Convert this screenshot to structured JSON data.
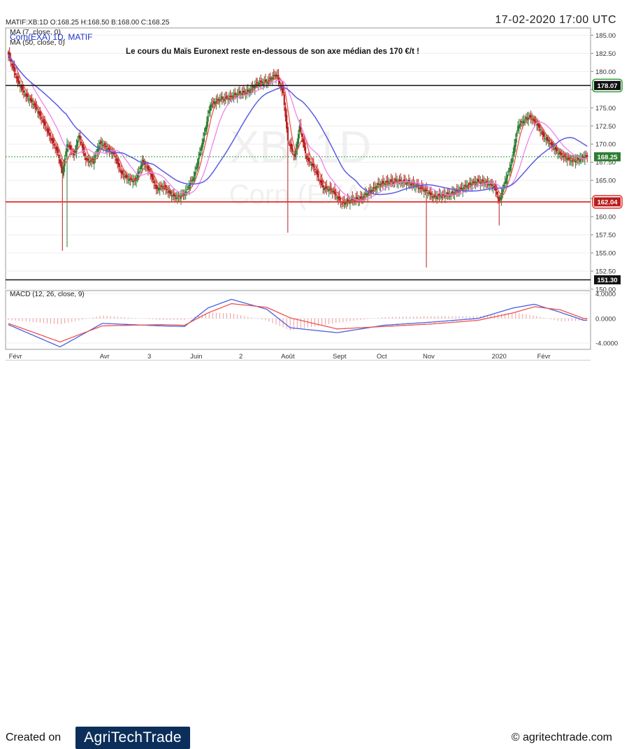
{
  "header": {
    "ohlc": "MATIF:XB:1D O:168.25 H:168.50 B:168.00 C:168.25",
    "datetime": "17-02-2020 17:00 UTC",
    "legend_ma7": "MA (7, close, 0)",
    "legend_symbol": "Corn(EXA) 1D, MATIF",
    "legend_ma50": "MA (50, close, 0)"
  },
  "annotation": "Le cours du Maïs Euronext reste en-dessous de son axe médian des 170 €/t !",
  "watermark": {
    "symbol": "XB, 1D",
    "name": "Corn (EXA)"
  },
  "footer": {
    "created_on": "Created on",
    "logo": "AgriTechTrade",
    "copyright": "© agritechtrade.com"
  },
  "colors": {
    "up": "#2e7d32",
    "down": "#b71c1c",
    "ma7": "#ef5350",
    "ma_pink": "#ee82ee",
    "ma50": "#5b5be6",
    "level_red": "#e53935",
    "level_black": "#111111",
    "macd": "#4a60e0",
    "signal": "#ef5350",
    "hist": "#ef9a9a",
    "badge_green": "#2e9e3a"
  },
  "chart_data": [
    {
      "type": "candlestick",
      "title": "",
      "x_tick_labels": [
        "Févr",
        "Avr",
        "3",
        "Juin",
        "2",
        "Août",
        "Sept",
        "Oct",
        "Nov",
        "2020",
        "Févr"
      ],
      "ylim": [
        150,
        186
      ],
      "y_ticks": [
        "185.00",
        "182.50",
        "180.00",
        "177.50",
        "175.00",
        "172.50",
        "170.00",
        "167.50",
        "165.00",
        "162.50",
        "160.00",
        "157.50",
        "155.00",
        "152.50",
        "150.00"
      ],
      "last_close": 168.25,
      "levels": [
        {
          "value": 178.07,
          "label": "178.07",
          "color": "black",
          "badge": "green"
        },
        {
          "value": 168.25,
          "label": "168.25",
          "color": "green-dotted",
          "badge": "current"
        },
        {
          "value": 162.04,
          "label": "162.04",
          "color": "red",
          "badge": "red"
        },
        {
          "value": 151.3,
          "label": "151.30",
          "color": "black",
          "badge": "none"
        }
      ],
      "series_anchors": {
        "close": [
          [
            0,
            182.3
          ],
          [
            8,
            178.6
          ],
          [
            14,
            176.8
          ],
          [
            22,
            175.4
          ],
          [
            30,
            172.9
          ],
          [
            36,
            170.8
          ],
          [
            42,
            168.8
          ],
          [
            46,
            166.0
          ],
          [
            50,
            170.0
          ],
          [
            56,
            168.5
          ],
          [
            60,
            171.2
          ],
          [
            66,
            167.8
          ],
          [
            72,
            167.6
          ],
          [
            78,
            170.2
          ],
          [
            84,
            169.4
          ],
          [
            90,
            168.6
          ],
          [
            96,
            166.0
          ],
          [
            102,
            165.2
          ],
          [
            108,
            164.9
          ],
          [
            114,
            167.6
          ],
          [
            120,
            166.3
          ],
          [
            126,
            163.8
          ],
          [
            132,
            164.2
          ],
          [
            138,
            163.1
          ],
          [
            144,
            162.6
          ],
          [
            150,
            163.2
          ],
          [
            158,
            165.5
          ],
          [
            166,
            170.8
          ],
          [
            172,
            175.4
          ],
          [
            180,
            176.2
          ],
          [
            188,
            176.4
          ],
          [
            196,
            177.0
          ],
          [
            204,
            177.2
          ],
          [
            212,
            178.4
          ],
          [
            220,
            178.6
          ],
          [
            228,
            179.6
          ],
          [
            234,
            177.0
          ],
          [
            238,
            170.5
          ],
          [
            244,
            168.2
          ],
          [
            248,
            172.5
          ],
          [
            254,
            168.0
          ],
          [
            260,
            166.8
          ],
          [
            268,
            164.0
          ],
          [
            276,
            163.6
          ],
          [
            284,
            161.8
          ],
          [
            292,
            162.3
          ],
          [
            300,
            162.5
          ],
          [
            308,
            163.5
          ],
          [
            316,
            164.5
          ],
          [
            324,
            164.8
          ],
          [
            332,
            164.9
          ],
          [
            340,
            164.7
          ],
          [
            348,
            164.2
          ],
          [
            356,
            163.5
          ],
          [
            362,
            162.7
          ],
          [
            368,
            162.9
          ],
          [
            376,
            163.1
          ],
          [
            384,
            163.7
          ],
          [
            392,
            164.4
          ],
          [
            400,
            164.9
          ],
          [
            408,
            164.6
          ],
          [
            414,
            164.1
          ],
          [
            418,
            162.0
          ],
          [
            422,
            164.4
          ],
          [
            428,
            167.2
          ],
          [
            434,
            172.5
          ],
          [
            440,
            173.4
          ],
          [
            444,
            173.8
          ],
          [
            450,
            172.8
          ],
          [
            456,
            171.0
          ],
          [
            462,
            170.0
          ],
          [
            468,
            168.8
          ],
          [
            474,
            168.2
          ],
          [
            480,
            167.7
          ],
          [
            486,
            167.9
          ],
          [
            490,
            168.25
          ]
        ]
      },
      "spikes": [
        {
          "index": 46,
          "low": 155.3
        },
        {
          "index": 50,
          "low": 155.8
        },
        {
          "index": 238,
          "low": 157.8
        },
        {
          "index": 356,
          "low": 153.0
        },
        {
          "index": 418,
          "low": 158.8
        }
      ]
    },
    {
      "type": "line",
      "title": "MACD (12, 26, close, 9)",
      "ylim": [
        -5,
        4.5
      ],
      "y_ticks": [
        "4.0000",
        "0.0000",
        "-4.0000"
      ],
      "series_anchors": {
        "macd": [
          [
            0,
            -1.0
          ],
          [
            44,
            -4.6
          ],
          [
            80,
            -0.8
          ],
          [
            130,
            -1.2
          ],
          [
            150,
            -1.3
          ],
          [
            170,
            1.7
          ],
          [
            190,
            3.1
          ],
          [
            220,
            1.5
          ],
          [
            240,
            -1.5
          ],
          [
            280,
            -2.3
          ],
          [
            320,
            -1.1
          ],
          [
            360,
            -0.6
          ],
          [
            400,
            0.0
          ],
          [
            430,
            1.7
          ],
          [
            448,
            2.3
          ],
          [
            470,
            1.0
          ],
          [
            490,
            -0.3
          ]
        ],
        "signal": [
          [
            0,
            -0.8
          ],
          [
            44,
            -3.8
          ],
          [
            80,
            -1.2
          ],
          [
            130,
            -1.0
          ],
          [
            150,
            -1.1
          ],
          [
            170,
            0.9
          ],
          [
            190,
            2.4
          ],
          [
            220,
            1.8
          ],
          [
            240,
            0.1
          ],
          [
            280,
            -1.7
          ],
          [
            320,
            -1.3
          ],
          [
            360,
            -0.9
          ],
          [
            400,
            -0.3
          ],
          [
            430,
            0.9
          ],
          [
            448,
            1.9
          ],
          [
            470,
            1.4
          ],
          [
            490,
            0.0
          ]
        ]
      }
    }
  ]
}
